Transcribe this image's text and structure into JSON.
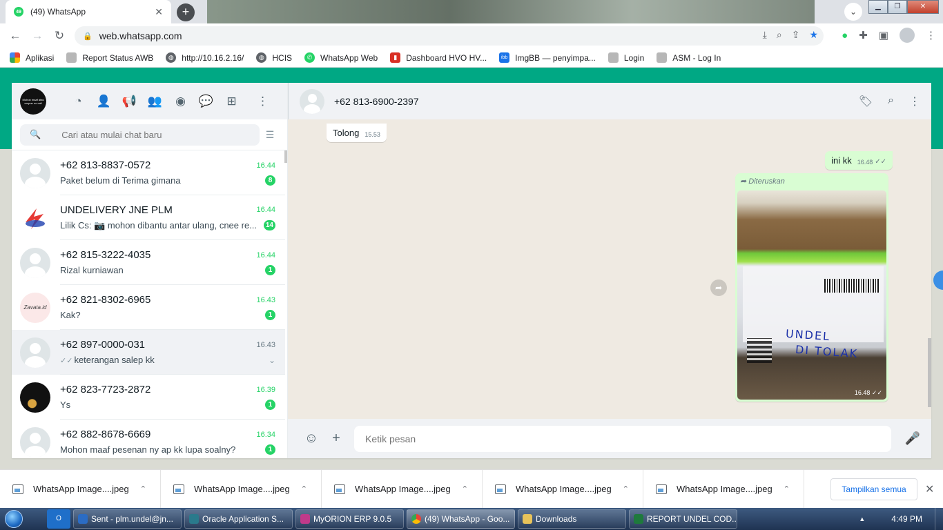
{
  "browser": {
    "tab_title": "(49) WhatsApp",
    "tab_badge": "49",
    "url": "web.whatsapp.com"
  },
  "bookmarks": [
    {
      "label": "Aplikasi",
      "icon": "apps-grid-icon"
    },
    {
      "label": "Report Status AWB",
      "icon": "generic-page-icon"
    },
    {
      "label": "http://10.16.2.16/",
      "icon": "globe-icon"
    },
    {
      "label": "HCIS",
      "icon": "globe-icon"
    },
    {
      "label": "WhatsApp Web",
      "icon": "whatsapp-icon"
    },
    {
      "label": "Dashboard HVO HV...",
      "icon": "dashboard-icon"
    },
    {
      "label": "ImgBB — penyimpa...",
      "icon": "imgbb-icon"
    },
    {
      "label": "Login",
      "icon": "generic-page-icon"
    },
    {
      "label": "ASM - Log In",
      "icon": "generic-page-icon"
    }
  ],
  "sidebar": {
    "search_placeholder": "Cari atau mulai chat baru",
    "chats": [
      {
        "name": "+62 813-8837-0572",
        "time": "16.44",
        "message": "Paket belum di Terima gimana",
        "badge": "8",
        "avatar": "default"
      },
      {
        "name": "UNDELIVERY JNE PLM",
        "time": "16.44",
        "message": "Lilik Cs: 📷 mohon dibantu antar ulang, cnee re...",
        "badge": "14",
        "avatar": "jne"
      },
      {
        "name": "+62 815-3222-4035",
        "time": "16.44",
        "message": "Rizal kurniawan",
        "badge": "1",
        "avatar": "default"
      },
      {
        "name": "+62 821-8302-6965",
        "time": "16.43",
        "message": "Kak?",
        "badge": "1",
        "avatar": "zav"
      },
      {
        "name": "+62 897-0000-031",
        "time": "16.43",
        "message": "keterangan salep kk",
        "badge": "",
        "avatar": "default",
        "active": true
      },
      {
        "name": "+62 823-7723-2872",
        "time": "16.39",
        "message": "Ys",
        "badge": "1",
        "avatar": "dark"
      },
      {
        "name": "+62 882-8678-6669",
        "time": "16.34",
        "message": "Mohon maaf pesenan ny ap kk lupa soalny?",
        "badge": "1",
        "avatar": "default"
      }
    ],
    "zav_avatar_text": "Zavata.id",
    "me_avatar_text": "Mohon maaf atas respon no call"
  },
  "conversation": {
    "title": "+62 813-6900-2397",
    "incoming": {
      "text": "Tolong",
      "time": "15.53"
    },
    "outgoing": {
      "text": "ini kk",
      "time": "16.48"
    },
    "image_message": {
      "forwarded_label": "Diteruskan",
      "time": "16.48",
      "handwriting_1": "UNDEL",
      "handwriting_2": "DI TOLAK"
    },
    "input_placeholder": "Ketik pesan"
  },
  "downloads": {
    "items": [
      "WhatsApp Image....jpeg",
      "WhatsApp Image....jpeg",
      "WhatsApp Image....jpeg",
      "WhatsApp Image....jpeg",
      "WhatsApp Image....jpeg"
    ],
    "show_all_label": "Tampilkan semua"
  },
  "taskbar": {
    "tasks": [
      {
        "label": "Sent - plm.undel@jn...",
        "color": "#2b6cc4"
      },
      {
        "label": "Oracle Application S...",
        "color": "#2a7a8c"
      },
      {
        "label": "MyORION ERP 9.0.5",
        "color": "#c03a8a"
      },
      {
        "label": "(49) WhatsApp - Goo...",
        "color": "#e8a43a",
        "active": true
      },
      {
        "label": "Downloads",
        "color": "#e8c35a"
      },
      {
        "label": "REPORT UNDEL COD...",
        "color": "#1e7a3c"
      }
    ],
    "clock": "4:49 PM"
  }
}
